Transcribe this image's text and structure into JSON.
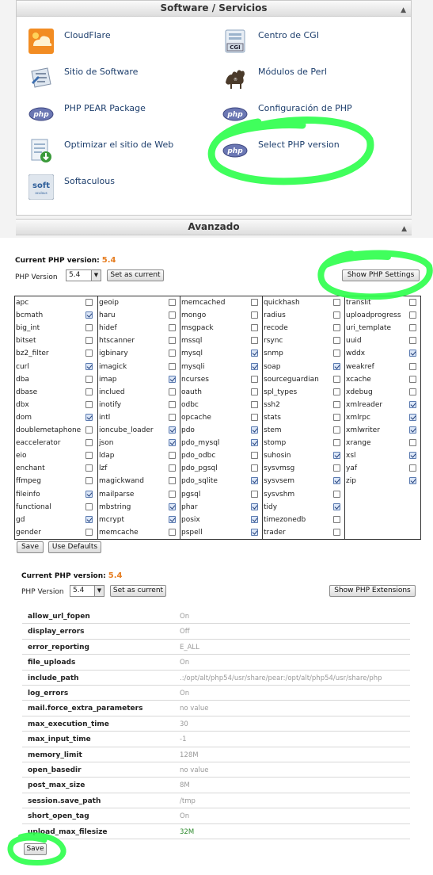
{
  "software_panel": {
    "header": "Software / Servicios",
    "next_header": "Avanzado",
    "items": [
      {
        "label": "CloudFlare",
        "icon": "cloudflare-icon"
      },
      {
        "label": "Centro de CGI",
        "icon": "cgi-icon"
      },
      {
        "label": "Sitio de Software",
        "icon": "software-site-icon"
      },
      {
        "label": "Módulos de Perl",
        "icon": "perl-camel-icon"
      },
      {
        "label": "PHP PEAR Package",
        "icon": "php-icon"
      },
      {
        "label": "Configuración de PHP",
        "icon": "php-icon"
      },
      {
        "label": "Optimizar el sitio de Web",
        "icon": "optimize-icon"
      },
      {
        "label": "Select PHP version",
        "icon": "php-icon"
      },
      {
        "label": "Softaculous",
        "icon": "softaculous-icon"
      }
    ]
  },
  "extensions_view": {
    "current_label": "Current PHP version:",
    "current_value": "5.4",
    "version_label": "PHP Version",
    "version_selected": "5.4",
    "set_current": "Set as current",
    "toggle_button": "Show PHP Settings",
    "save": "Save",
    "use_defaults": "Use Defaults",
    "columns": [
      [
        {
          "name": "apc",
          "checked": false
        },
        {
          "name": "bcmath",
          "checked": true
        },
        {
          "name": "big_int",
          "checked": false
        },
        {
          "name": "bitset",
          "checked": false
        },
        {
          "name": "bz2_filter",
          "checked": false
        },
        {
          "name": "curl",
          "checked": true
        },
        {
          "name": "dba",
          "checked": false
        },
        {
          "name": "dbase",
          "checked": false
        },
        {
          "name": "dbx",
          "checked": false
        },
        {
          "name": "dom",
          "checked": true
        },
        {
          "name": "doublemetaphone",
          "checked": false
        },
        {
          "name": "eaccelerator",
          "checked": false
        },
        {
          "name": "eio",
          "checked": false
        },
        {
          "name": "enchant",
          "checked": false
        },
        {
          "name": "ffmpeg",
          "checked": false
        },
        {
          "name": "fileinfo",
          "checked": true
        },
        {
          "name": "functional",
          "checked": false
        },
        {
          "name": "gd",
          "checked": true
        },
        {
          "name": "gender",
          "checked": false
        }
      ],
      [
        {
          "name": "geoip",
          "checked": false
        },
        {
          "name": "haru",
          "checked": false
        },
        {
          "name": "hidef",
          "checked": false
        },
        {
          "name": "htscanner",
          "checked": false
        },
        {
          "name": "igbinary",
          "checked": false
        },
        {
          "name": "imagick",
          "checked": false
        },
        {
          "name": "imap",
          "checked": true
        },
        {
          "name": "inclued",
          "checked": false
        },
        {
          "name": "inotify",
          "checked": false
        },
        {
          "name": "intl",
          "checked": false
        },
        {
          "name": "ioncube_loader",
          "checked": true
        },
        {
          "name": "json",
          "checked": true
        },
        {
          "name": "ldap",
          "checked": false
        },
        {
          "name": "lzf",
          "checked": false
        },
        {
          "name": "magickwand",
          "checked": false
        },
        {
          "name": "mailparse",
          "checked": false
        },
        {
          "name": "mbstring",
          "checked": true
        },
        {
          "name": "mcrypt",
          "checked": true
        },
        {
          "name": "memcache",
          "checked": false
        }
      ],
      [
        {
          "name": "memcached",
          "checked": false
        },
        {
          "name": "mongo",
          "checked": false
        },
        {
          "name": "msgpack",
          "checked": false
        },
        {
          "name": "mssql",
          "checked": false
        },
        {
          "name": "mysql",
          "checked": true
        },
        {
          "name": "mysqli",
          "checked": true
        },
        {
          "name": "ncurses",
          "checked": false
        },
        {
          "name": "oauth",
          "checked": false
        },
        {
          "name": "odbc",
          "checked": false
        },
        {
          "name": "opcache",
          "checked": false
        },
        {
          "name": "pdo",
          "checked": true
        },
        {
          "name": "pdo_mysql",
          "checked": true
        },
        {
          "name": "pdo_odbc",
          "checked": false
        },
        {
          "name": "pdo_pgsql",
          "checked": false
        },
        {
          "name": "pdo_sqlite",
          "checked": true
        },
        {
          "name": "pgsql",
          "checked": false
        },
        {
          "name": "phar",
          "checked": true
        },
        {
          "name": "posix",
          "checked": true
        },
        {
          "name": "pspell",
          "checked": true
        }
      ],
      [
        {
          "name": "quickhash",
          "checked": false
        },
        {
          "name": "radius",
          "checked": false
        },
        {
          "name": "recode",
          "checked": false
        },
        {
          "name": "rsync",
          "checked": false
        },
        {
          "name": "snmp",
          "checked": false
        },
        {
          "name": "soap",
          "checked": true
        },
        {
          "name": "sourceguardian",
          "checked": false
        },
        {
          "name": "spl_types",
          "checked": false
        },
        {
          "name": "ssh2",
          "checked": false
        },
        {
          "name": "stats",
          "checked": false
        },
        {
          "name": "stem",
          "checked": false
        },
        {
          "name": "stomp",
          "checked": false
        },
        {
          "name": "suhosin",
          "checked": true
        },
        {
          "name": "sysvmsg",
          "checked": false
        },
        {
          "name": "sysvsem",
          "checked": true
        },
        {
          "name": "sysvshm",
          "checked": false
        },
        {
          "name": "tidy",
          "checked": true
        },
        {
          "name": "timezonedb",
          "checked": false
        },
        {
          "name": "trader",
          "checked": false
        }
      ],
      [
        {
          "name": "translit",
          "checked": false
        },
        {
          "name": "uploadprogress",
          "checked": false
        },
        {
          "name": "uri_template",
          "checked": false
        },
        {
          "name": "uuid",
          "checked": false
        },
        {
          "name": "wddx",
          "checked": true
        },
        {
          "name": "weakref",
          "checked": false
        },
        {
          "name": "xcache",
          "checked": false
        },
        {
          "name": "xdebug",
          "checked": false
        },
        {
          "name": "xmlreader",
          "checked": true
        },
        {
          "name": "xmlrpc",
          "checked": true
        },
        {
          "name": "xmlwriter",
          "checked": true
        },
        {
          "name": "xrange",
          "checked": false
        },
        {
          "name": "xsl",
          "checked": true
        },
        {
          "name": "yaf",
          "checked": false
        },
        {
          "name": "zip",
          "checked": true
        }
      ]
    ]
  },
  "settings_view": {
    "current_label": "Current PHP version:",
    "current_value": "5.4",
    "version_label": "PHP Version",
    "version_selected": "5.4",
    "set_current": "Set as current",
    "toggle_button": "Show PHP Extensions",
    "save": "Save",
    "rows": [
      {
        "key": "allow_url_fopen",
        "value": "On"
      },
      {
        "key": "display_errors",
        "value": "Off"
      },
      {
        "key": "error_reporting",
        "value": "E_ALL"
      },
      {
        "key": "file_uploads",
        "value": "On"
      },
      {
        "key": "include_path",
        "value": ".:/opt/alt/php54/usr/share/pear:/opt/alt/php54/usr/share/php"
      },
      {
        "key": "log_errors",
        "value": "On"
      },
      {
        "key": "mail.force_extra_parameters",
        "value": "no value"
      },
      {
        "key": "max_execution_time",
        "value": "30"
      },
      {
        "key": "max_input_time",
        "value": "-1"
      },
      {
        "key": "memory_limit",
        "value": "128M"
      },
      {
        "key": "open_basedir",
        "value": "no value"
      },
      {
        "key": "post_max_size",
        "value": "8M"
      },
      {
        "key": "session.save_path",
        "value": "/tmp"
      },
      {
        "key": "short_open_tag",
        "value": "On"
      },
      {
        "key": "upload_max_filesize",
        "value": "32M",
        "highlight": true
      }
    ]
  },
  "colors": {
    "accent_orange": "#e67e22",
    "link_blue": "#1d3e6c",
    "highlighter_green": "#2bff4a"
  }
}
